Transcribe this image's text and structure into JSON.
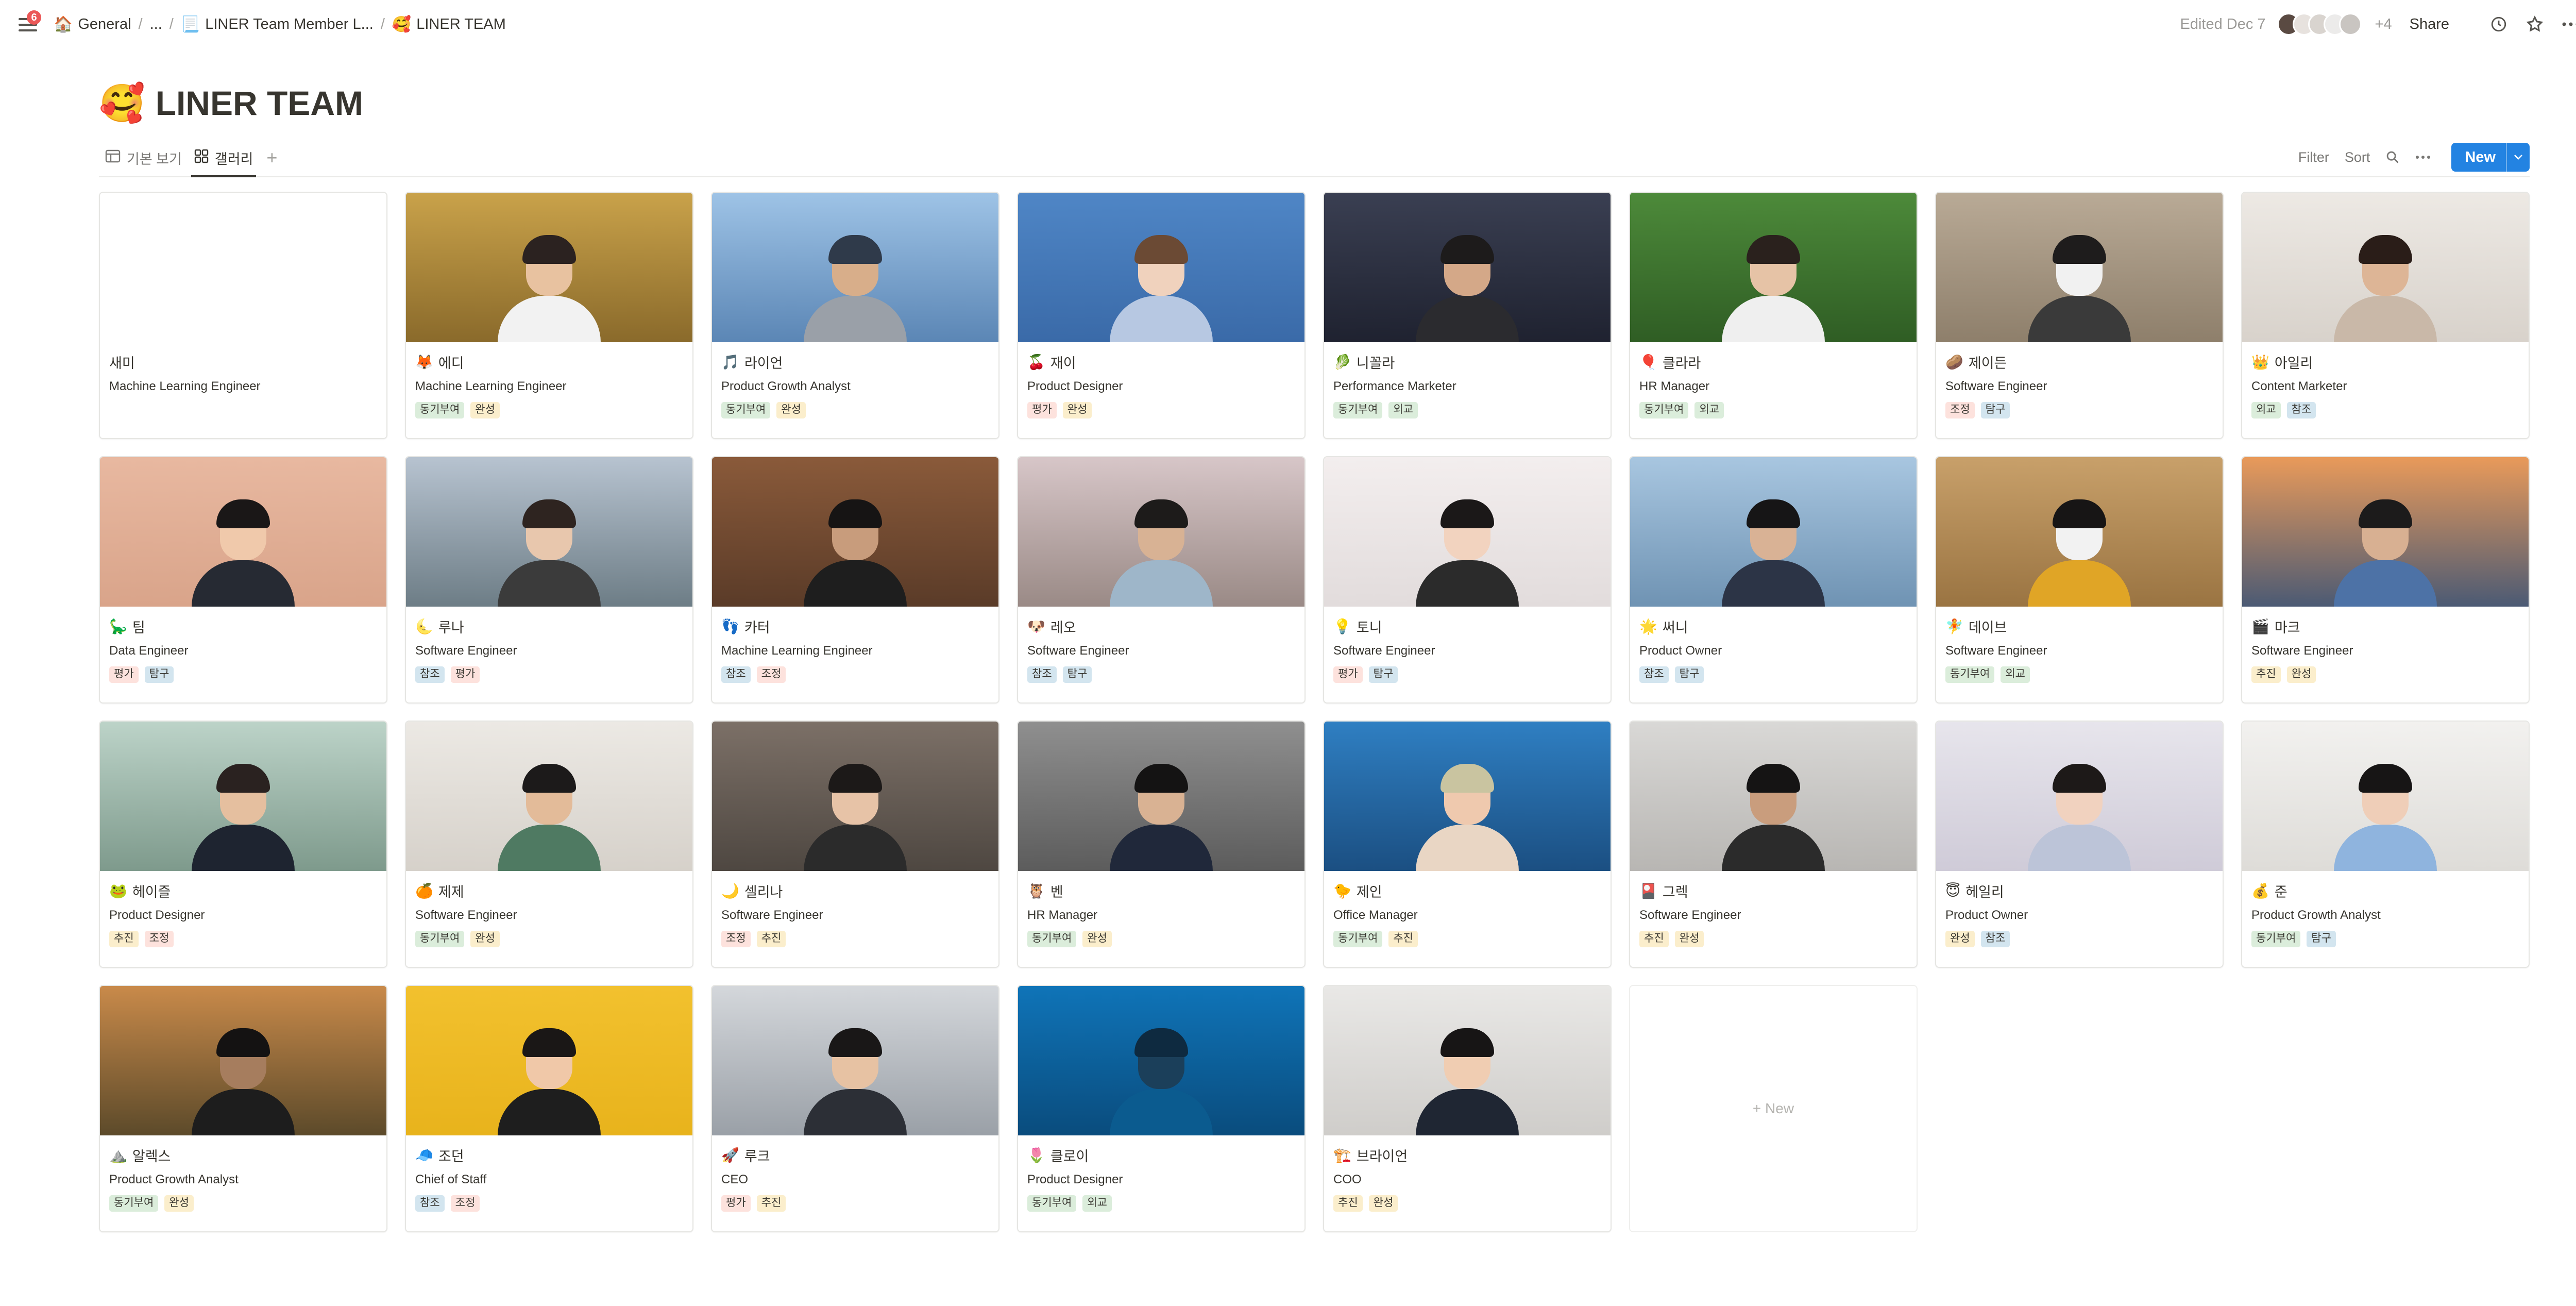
{
  "topbar": {
    "notification_count": "6",
    "breadcrumbs": [
      {
        "icon": "🏠",
        "label": "General"
      },
      {
        "icon": "",
        "label": "..."
      },
      {
        "icon": "📃",
        "label": "LINER Team Member L..."
      },
      {
        "icon": "🥰",
        "label": "LINER TEAM"
      }
    ],
    "edited": "Edited Dec 7",
    "more_avatars": "+4",
    "share_label": "Share"
  },
  "page": {
    "emoji": "🥰",
    "title": "LINER TEAM"
  },
  "views": {
    "tabs": [
      {
        "icon": "table-icon",
        "label": "기본 보기"
      },
      {
        "icon": "gallery-icon",
        "label": "갤러리"
      }
    ],
    "filter_label": "Filter",
    "sort_label": "Sort",
    "new_label": "New"
  },
  "tag_colors": {
    "동기부여": "#dbeddb",
    "완성": "#fbeecc",
    "평가": "#fde2dd",
    "외교": "#dbeddb",
    "조정": "#fde2dd",
    "탐구": "#d3e5ef",
    "참조": "#d3e5ef",
    "추진": "#fbeecc"
  },
  "members": [
    {
      "emoji": "",
      "name": "새미",
      "role": "Machine Learning Engineer",
      "tags": [],
      "photo": null
    },
    {
      "emoji": "🦊",
      "name": "에디",
      "role": "Machine Learning Engineer",
      "tags": [
        "동기부여",
        "완성"
      ],
      "photo": {
        "bg": [
          "#c9a24a",
          "#8a6a2b"
        ],
        "skin": "#e8c2a0",
        "hair": "#2b2220",
        "body": "#f2f2f2"
      }
    },
    {
      "emoji": "🎵",
      "name": "라이언",
      "role": "Product Growth Analyst",
      "tags": [
        "동기부여",
        "완성"
      ],
      "photo": {
        "bg": [
          "#9ec3e6",
          "#5b86b5"
        ],
        "skin": "#d8ae8a",
        "hair": "#2f3a4a",
        "body": "#9aa0a8"
      }
    },
    {
      "emoji": "🍒",
      "name": "재이",
      "role": "Product Designer",
      "tags": [
        "평가",
        "완성"
      ],
      "photo": {
        "bg": [
          "#4f86c6",
          "#3a6aa8"
        ],
        "skin": "#f0d2bd",
        "hair": "#6b4a34",
        "body": "#b7c8e2"
      }
    },
    {
      "emoji": "🥬",
      "name": "니꼴라",
      "role": "Performance Marketer",
      "tags": [
        "동기부여",
        "외교"
      ],
      "photo": {
        "bg": [
          "#3a3f52",
          "#1f2230"
        ],
        "skin": "#d4a888",
        "hair": "#1d1b1b",
        "body": "#2b2b2f"
      }
    },
    {
      "emoji": "🎈",
      "name": "클라라",
      "role": "HR Manager",
      "tags": [
        "동기부여",
        "외교"
      ],
      "photo": {
        "bg": [
          "#4d8a3a",
          "#2f5d24"
        ],
        "skin": "#e6c3a6",
        "hair": "#2a211d",
        "body": "#efefef"
      }
    },
    {
      "emoji": "🥔",
      "name": "제이든",
      "role": "Software Engineer",
      "tags": [
        "조정",
        "탐구"
      ],
      "photo": {
        "bg": [
          "#b9aa96",
          "#8e7f6b"
        ],
        "skin": "#f1f1f1",
        "hair": "#1e1c1c",
        "body": "#3a3a3a"
      }
    },
    {
      "emoji": "👑",
      "name": "아일리",
      "role": "Content Marketer",
      "tags": [
        "외교",
        "참조"
      ],
      "photo": {
        "bg": [
          "#ede9e4",
          "#d8d2cb"
        ],
        "skin": "#ddb596",
        "hair": "#2a1d18",
        "body": "#c9b8a8"
      }
    },
    {
      "emoji": "🦕",
      "name": "팀",
      "role": "Data Engineer",
      "tags": [
        "평가",
        "탐구"
      ],
      "photo": {
        "bg": [
          "#e8b8a0",
          "#d9a48a"
        ],
        "skin": "#f0c9ab",
        "hair": "#1a1717",
        "body": "#262a33"
      }
    },
    {
      "emoji": "🌜",
      "name": "루나",
      "role": "Software Engineer",
      "tags": [
        "참조",
        "평가"
      ],
      "photo": {
        "bg": [
          "#b7c3d0",
          "#6d7d86"
        ],
        "skin": "#e8c7ad",
        "hair": "#2e2420",
        "body": "#3b3b3b"
      }
    },
    {
      "emoji": "👣",
      "name": "카터",
      "role": "Machine Learning Engineer",
      "tags": [
        "참조",
        "조정"
      ],
      "photo": {
        "bg": [
          "#8a5a3a",
          "#5a3b28"
        ],
        "skin": "#c89c7c",
        "hair": "#161414",
        "body": "#1e1e1e"
      }
    },
    {
      "emoji": "🐶",
      "name": "레오",
      "role": "Software Engineer",
      "tags": [
        "참조",
        "탐구"
      ],
      "photo": {
        "bg": [
          "#d7c6c8",
          "#9a8a86"
        ],
        "skin": "#d8b294",
        "hair": "#1d1b1a",
        "body": "#9eb6c9"
      }
    },
    {
      "emoji": "💡",
      "name": "토니",
      "role": "Software Engineer",
      "tags": [
        "평가",
        "탐구"
      ],
      "photo": {
        "bg": [
          "#f3eeee",
          "#e2dcdc"
        ],
        "skin": "#f2d3bf",
        "hair": "#1b1818",
        "body": "#2b2b2b"
      }
    },
    {
      "emoji": "🌟",
      "name": "써니",
      "role": "Product Owner",
      "tags": [
        "참조",
        "탐구"
      ],
      "photo": {
        "bg": [
          "#a8c6e0",
          "#6f93b3"
        ],
        "skin": "#d9b295",
        "hair": "#161516",
        "body": "#2c3446"
      }
    },
    {
      "emoji": "🧚",
      "name": "데이브",
      "role": "Software Engineer",
      "tags": [
        "동기부여",
        "외교"
      ],
      "photo": {
        "bg": [
          "#c8a06a",
          "#9a7442"
        ],
        "skin": "#f2f2f2",
        "hair": "#171515",
        "body": "#e0a526"
      }
    },
    {
      "emoji": "🎬",
      "name": "마크",
      "role": "Software Engineer",
      "tags": [
        "추진",
        "완성"
      ],
      "photo": {
        "bg": [
          "#e99a5a",
          "#4b5a74"
        ],
        "skin": "#d8b092",
        "hair": "#1c1b1b",
        "body": "#4d72a6"
      }
    },
    {
      "emoji": "🐸",
      "name": "헤이즐",
      "role": "Product Designer",
      "tags": [
        "추진",
        "조정"
      ],
      "photo": {
        "bg": [
          "#bcd3c8",
          "#7e9a8c"
        ],
        "skin": "#e5bf9f",
        "hair": "#2a2220",
        "body": "#1e2430"
      }
    },
    {
      "emoji": "🍊",
      "name": "제제",
      "role": "Software Engineer",
      "tags": [
        "동기부여",
        "완성"
      ],
      "photo": {
        "bg": [
          "#ece9e4",
          "#d6d1ca"
        ],
        "skin": "#e3bb99",
        "hair": "#1c1a1a",
        "body": "#4f7a62"
      }
    },
    {
      "emoji": "🌙",
      "name": "셀리나",
      "role": "Software Engineer",
      "tags": [
        "조정",
        "추진"
      ],
      "photo": {
        "bg": [
          "#7c7067",
          "#4e4741"
        ],
        "skin": "#e7c3a7",
        "hair": "#1c1918",
        "body": "#2b2b2b"
      }
    },
    {
      "emoji": "🦉",
      "name": "벤",
      "role": "HR Manager",
      "tags": [
        "동기부여",
        "완성"
      ],
      "photo": {
        "bg": [
          "#8f8f8f",
          "#5c5c5c"
        ],
        "skin": "#d9b293",
        "hair": "#141313",
        "body": "#20283a"
      }
    },
    {
      "emoji": "🐤",
      "name": "제인",
      "role": "Office Manager",
      "tags": [
        "동기부여",
        "추진"
      ],
      "photo": {
        "bg": [
          "#2f7fc2",
          "#1b4f82"
        ],
        "skin": "#efc9ae",
        "hair": "#c9c4a0",
        "body": "#e9d6c4"
      }
    },
    {
      "emoji": "🎴",
      "name": "그렉",
      "role": "Software Engineer",
      "tags": [
        "추진",
        "완성"
      ],
      "photo": {
        "bg": [
          "#d9d8d6",
          "#b8b6b3"
        ],
        "skin": "#c99d7d",
        "hair": "#151414",
        "body": "#2b2b2b"
      }
    },
    {
      "emoji": "😇",
      "name": "헤일리",
      "role": "Product Owner",
      "tags": [
        "완성",
        "참조"
      ],
      "photo": {
        "bg": [
          "#e7e5ec",
          "#cfcbd8"
        ],
        "skin": "#f1d2bf",
        "hair": "#1d1918",
        "body": "#bcc4d8"
      }
    },
    {
      "emoji": "💰",
      "name": "준",
      "role": "Product Growth Analyst",
      "tags": [
        "동기부여",
        "탐구"
      ],
      "photo": {
        "bg": [
          "#f2f1ef",
          "#dedcd8"
        ],
        "skin": "#efceb8",
        "hair": "#171515",
        "body": "#8fb4de"
      }
    },
    {
      "emoji": "⛰️",
      "name": "알렉스",
      "role": "Product Growth Analyst",
      "tags": [
        "동기부여",
        "완성"
      ],
      "photo": {
        "bg": [
          "#c98a4a",
          "#5c4a2a"
        ],
        "skin": "#a67d5e",
        "hair": "#141212",
        "body": "#1d1d1d"
      }
    },
    {
      "emoji": "🧢",
      "name": "조던",
      "role": "Chief of Staff",
      "tags": [
        "참조",
        "조정"
      ],
      "photo": {
        "bg": [
          "#f2c12e",
          "#e8b31c"
        ],
        "skin": "#f0c8a8",
        "hair": "#1a1716",
        "body": "#1e1e1e"
      }
    },
    {
      "emoji": "🚀",
      "name": "루크",
      "role": "CEO",
      "tags": [
        "평가",
        "추진"
      ],
      "photo": {
        "bg": [
          "#d4d7db",
          "#9aa0a7"
        ],
        "skin": "#e7c2a3",
        "hair": "#191717",
        "body": "#2c2f36"
      }
    },
    {
      "emoji": "🌷",
      "name": "클로이",
      "role": "Product Designer",
      "tags": [
        "동기부여",
        "외교"
      ],
      "photo": {
        "bg": [
          "#0f74b8",
          "#0a4c7d"
        ],
        "skin": "#1b3f5a",
        "hair": "#0e2a40",
        "body": "#0b5b8f"
      }
    },
    {
      "emoji": "🏗️",
      "name": "브라이언",
      "role": "COO",
      "tags": [
        "추진",
        "완성"
      ],
      "photo": {
        "bg": [
          "#e9e8e6",
          "#cfcdca"
        ],
        "skin": "#f0cdb2",
        "hair": "#171515",
        "body": "#1f2633"
      }
    }
  ],
  "new_card_label": "+ New"
}
